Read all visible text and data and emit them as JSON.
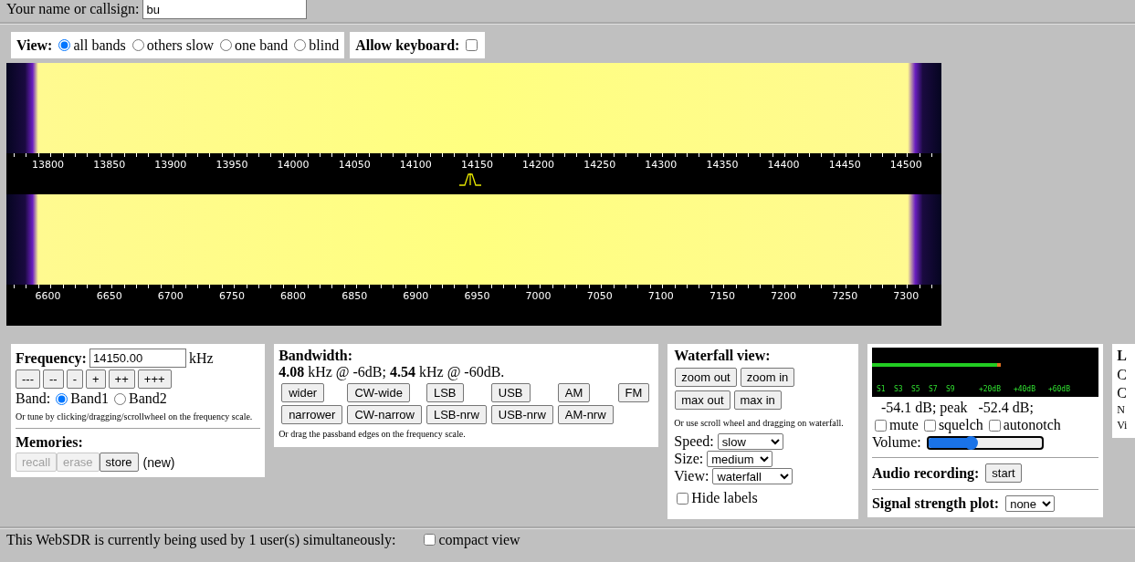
{
  "callsign": {
    "label": "Your name or callsign:",
    "value": "bu"
  },
  "view": {
    "label": "View:",
    "options": [
      {
        "label": "all bands",
        "selected": true
      },
      {
        "label": "others slow",
        "selected": false
      },
      {
        "label": "one band",
        "selected": false
      },
      {
        "label": "blind",
        "selected": false
      }
    ]
  },
  "keyboard": {
    "label": "Allow keyboard:",
    "checked": false
  },
  "bands_display": [
    {
      "scale_labels": [
        "13800",
        "13850",
        "13900",
        "13950",
        "14000",
        "14050",
        "14100",
        "14150",
        "14200",
        "14250",
        "14300",
        "14350",
        "14400",
        "14450",
        "14500"
      ],
      "passband_marker": true
    },
    {
      "scale_labels": [
        "6600",
        "6650",
        "6700",
        "6750",
        "6800",
        "6850",
        "6900",
        "6950",
        "7000",
        "7050",
        "7100",
        "7150",
        "7200",
        "7250",
        "7300"
      ],
      "passband_marker": false
    }
  ],
  "frequency": {
    "label": "Frequency:",
    "value": "14150.00",
    "unit": "kHz",
    "step_buttons": [
      "---",
      "--",
      "-",
      "+",
      "++",
      "+++"
    ],
    "band_label": "Band:",
    "bands": [
      {
        "label": "Band1",
        "selected": true
      },
      {
        "label": "Band2",
        "selected": false
      }
    ],
    "hint": "Or tune by clicking/dragging/scrollwheel on the frequency scale.",
    "memories": {
      "title": "Memories:",
      "buttons": [
        {
          "label": "recall",
          "disabled": true
        },
        {
          "label": "erase",
          "disabled": true
        },
        {
          "label": "store",
          "disabled": false
        }
      ],
      "note": "(new)"
    }
  },
  "bandwidth": {
    "title": "Bandwidth:",
    "readout": "**4.08** kHz @ -6dB; **4.54** kHz @ -60dB.",
    "buttons": [
      [
        "wider",
        "CW-wide",
        "LSB",
        "USB",
        "AM",
        "FM"
      ],
      [
        "narrower",
        "CW-narrow",
        "LSB-nrw",
        "USB-nrw",
        "AM-nrw"
      ]
    ],
    "hint": "Or drag the passband edges on the frequency scale."
  },
  "waterfall_view": {
    "title": "Waterfall view:",
    "buttons": [
      [
        "zoom out",
        "zoom in"
      ],
      [
        "max out",
        "max in"
      ]
    ],
    "hint": "Or use scroll wheel and dragging on waterfall.",
    "selects": [
      {
        "label": "Speed:",
        "value": "slow"
      },
      {
        "label": "Size:",
        "value": "medium"
      },
      {
        "label": "View:",
        "value": "waterfall"
      }
    ],
    "hide_labels": {
      "label": "Hide labels",
      "checked": false
    }
  },
  "audio": {
    "smeter": {
      "level": 0.57,
      "scale": [
        "S1",
        "S3",
        "S5",
        "S7",
        "S9",
        "+20dB",
        "+40dB",
        "+60dB"
      ]
    },
    "readout": "-54.1 dB; peak   -52.4 dB;",
    "toggles": [
      {
        "label": "mute",
        "checked": false
      },
      {
        "label": "squelch",
        "checked": false
      },
      {
        "label": "autonotch",
        "checked": false
      }
    ],
    "volume": {
      "label": "Volume:",
      "level": 0.38
    },
    "recording": {
      "label": "Audio recording:",
      "button": "start"
    },
    "plot": {
      "label": "Signal strength plot:",
      "value": "none"
    }
  },
  "side_panel": {
    "lines": [
      {
        "kind": "heading",
        "text": "L"
      },
      {
        "kind": "text",
        "text": "C"
      },
      {
        "kind": "text",
        "text": "C"
      },
      {
        "kind": "small",
        "text": "N"
      },
      {
        "kind": "small",
        "text": "Vi"
      }
    ]
  },
  "footer": {
    "text": "This WebSDR is currently being used by 1 user(s) simultaneously:",
    "compact_view": {
      "label": "compact view",
      "checked": false
    }
  }
}
